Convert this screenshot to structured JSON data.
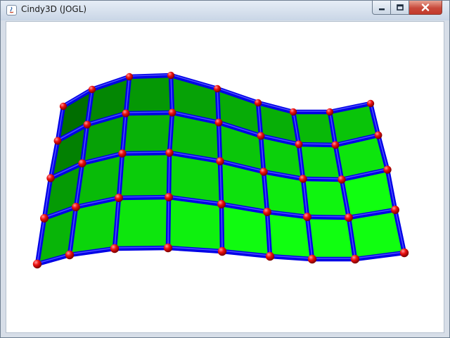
{
  "window": {
    "title": "Cindy3D (JOGL)",
    "app_icon": "java-icon",
    "controls": {
      "minimize_icon": "minimize-icon",
      "maximize_icon": "maximize-icon",
      "close_icon": "close-icon"
    }
  },
  "scene": {
    "grid_columns": 8,
    "grid_rows": 4,
    "colors": {
      "face_dark": "#006e00",
      "face_bright": "#10ff10",
      "tube": "#0000e6",
      "node": "#e60000",
      "background": "#ffffff"
    }
  }
}
